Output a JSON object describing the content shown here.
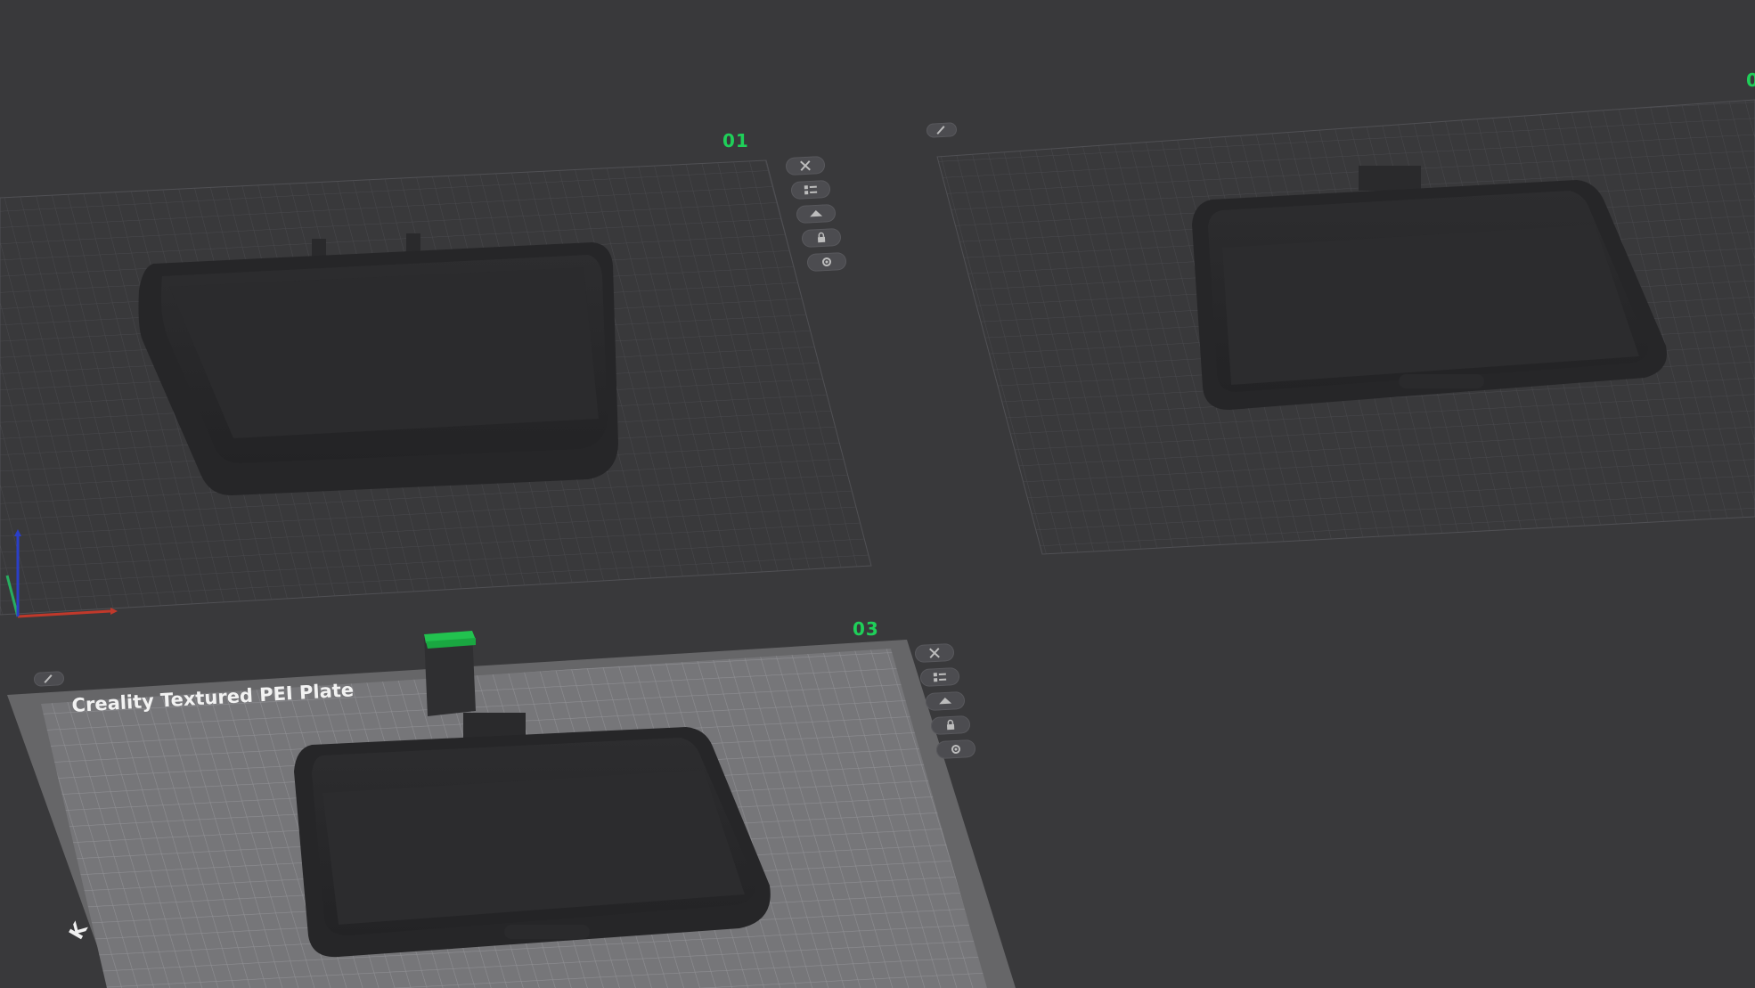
{
  "viewport": {
    "background_color": "#39393b",
    "accent_color": "#1fcf59"
  },
  "plates": [
    {
      "number": "01",
      "name": "",
      "icons": [
        "close-icon",
        "arrange-icon",
        "orient-icon",
        "lock-icon",
        "settings-icon"
      ]
    },
    {
      "number": "0",
      "name": "",
      "icons": [
        "edit-icon"
      ]
    },
    {
      "number": "03",
      "name": "Creality Textured PEI Plate",
      "icons": [
        "close-icon",
        "arrange-icon",
        "orient-icon",
        "lock-icon",
        "settings-icon",
        "edit-icon"
      ]
    }
  ],
  "axes": {
    "x_color": "#c0392b",
    "y_color": "#27ae60",
    "z_color": "#2a3fc8"
  }
}
